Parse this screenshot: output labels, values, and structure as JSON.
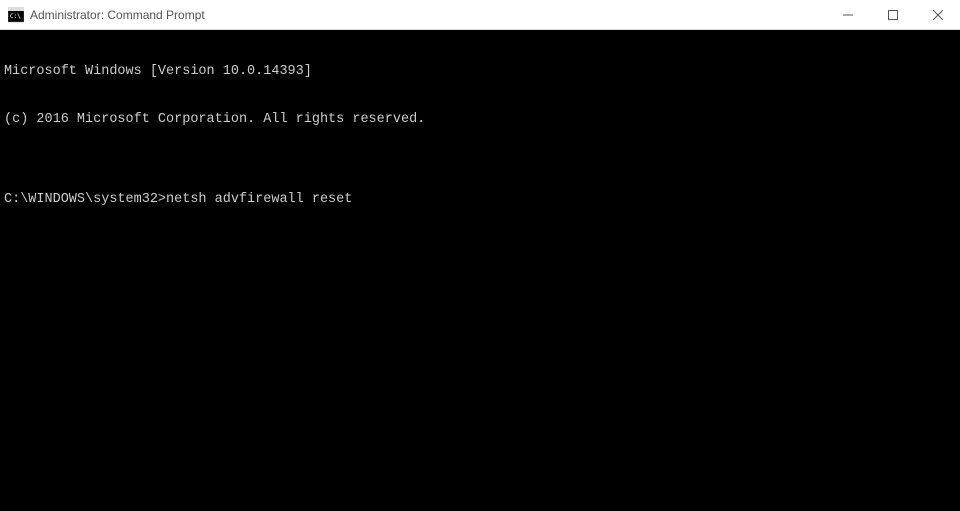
{
  "titlebar": {
    "title": "Administrator: Command Prompt"
  },
  "terminal": {
    "line1": "Microsoft Windows [Version 10.0.14393]",
    "line2": "(c) 2016 Microsoft Corporation. All rights reserved.",
    "blank": "",
    "prompt": "C:\\WINDOWS\\system32>",
    "command": "netsh advfirewall reset"
  }
}
